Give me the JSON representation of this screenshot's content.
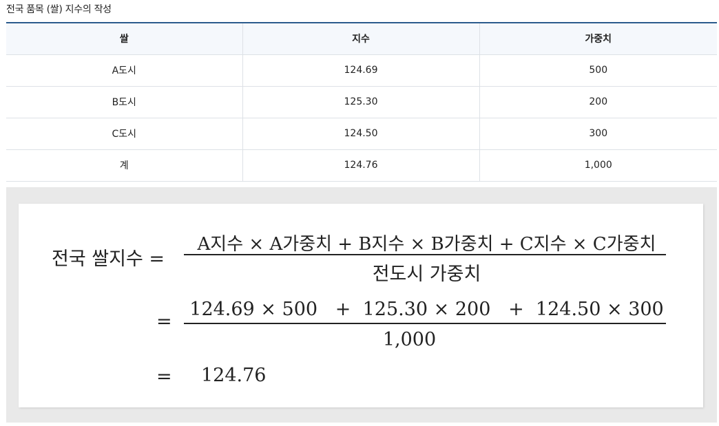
{
  "caption": "전국 품목 (쌀) 지수의 작성",
  "table": {
    "headers": [
      "쌀",
      "지수",
      "가중치"
    ],
    "rows": [
      [
        "A도시",
        "124.69",
        "500"
      ],
      [
        "B도시",
        "125.30",
        "200"
      ],
      [
        "C도시",
        "124.50",
        "300"
      ],
      [
        "계",
        "124.76",
        "1,000"
      ]
    ]
  },
  "formula": {
    "lhs": "전국 쌀지수 =",
    "step1": {
      "numerator": "A지수 × A가중치 + B지수 × B가중치 + C지수 × C가중치",
      "denominator": "전도시 가중치"
    },
    "step2": {
      "equals": "=",
      "numerator": "124.69 × 500   +  125.30 × 200   +  124.50 × 300",
      "denominator": "1,000"
    },
    "step3": {
      "equals": "=",
      "result": "124.76"
    }
  }
}
